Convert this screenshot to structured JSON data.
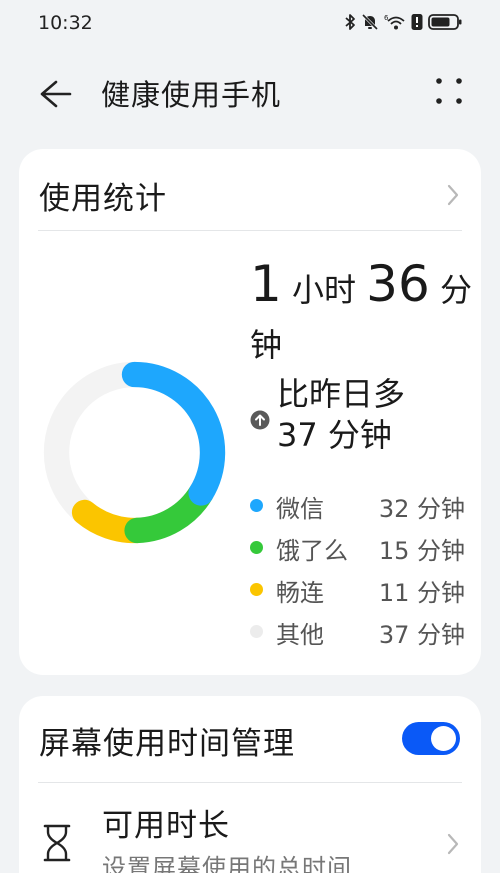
{
  "status_bar": {
    "time": "10:32",
    "icons": [
      "bluetooth-icon",
      "mute-icon",
      "wifi-6-icon",
      "alert-icon",
      "battery-icon"
    ]
  },
  "app_bar": {
    "title": "健康使用手机",
    "back_icon": "arrow-left-icon",
    "more_icon": "more-dots-icon"
  },
  "usage_card": {
    "title": "使用统计",
    "total": {
      "hours": "1",
      "hours_unit": "小时",
      "minutes": "36",
      "minutes_unit": "分钟"
    },
    "compare": {
      "line1": "比昨日多",
      "line2": "37 分钟"
    },
    "apps": [
      {
        "name": "微信",
        "value": "32 分钟",
        "minutes": 32,
        "color": "#1ea7fd"
      },
      {
        "name": "饿了么",
        "value": "15 分钟",
        "minutes": 15,
        "color": "#35c93a"
      },
      {
        "name": "畅连",
        "value": "11 分钟",
        "minutes": 11,
        "color": "#fbc500"
      },
      {
        "name": "其他",
        "value": "37 分钟",
        "minutes": 37,
        "color": "#ececec"
      }
    ]
  },
  "screen_card": {
    "title": "屏幕使用时间管理",
    "toggle_on": true,
    "row_title": "可用时长",
    "row_subtitle": "设置屏幕使用的总时间"
  }
}
